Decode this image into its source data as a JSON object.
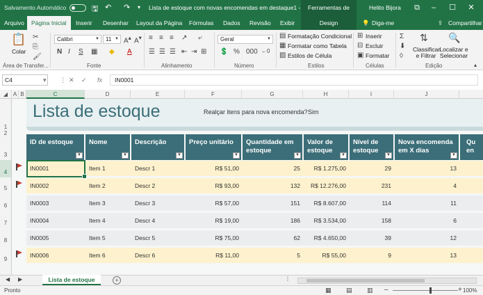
{
  "titlebar": {
    "autosave_label": "Salvamento Automático",
    "doc_title": "Lista de estoque com novas encomendas em destaque1 - Ex...",
    "tools_tab": "Ferramentas de Tabela",
    "user": "Helito Bijora",
    "icons": [
      "save-icon",
      "undo-icon",
      "redo-icon",
      "restore-icon",
      "minimize-icon",
      "maximize-icon",
      "close-icon"
    ]
  },
  "ribbon_tabs": {
    "arquivo": "Arquivo",
    "inicio": "Página Inicial",
    "inserir": "Inserir",
    "desenhar": "Desenhar",
    "layout": "Layout da Página",
    "formulas": "Fórmulas",
    "dados": "Dados",
    "revisao": "Revisão",
    "exibir": "Exibir",
    "design": "Design",
    "tell_me": "Diga-me",
    "share": "Compartilhar"
  },
  "ribbon": {
    "paste": "Colar",
    "font_name": "Calibri",
    "font_size": "11",
    "number_format": "Geral",
    "cond_format": "Formatação Condicional",
    "format_table": "Formatar como Tabela",
    "cell_styles": "Estilos de Célula",
    "insert": "Inserir",
    "delete": "Excluir",
    "format": "Formatar",
    "sort_filter": "Classificar e Filtrar",
    "find_select": "Localizar e Selecionar",
    "groups": {
      "clipboard": "Área de Transfer...",
      "font": "Fonte",
      "alignment": "Alinhamento",
      "number": "Número",
      "styles": "Estilos",
      "cells": "Células",
      "editing": "Edição"
    }
  },
  "formula_bar": {
    "name_box": "C4",
    "formula": "IN0001"
  },
  "columns": [
    "A",
    "B",
    "C",
    "D",
    "E",
    "F",
    "G",
    "H",
    "I",
    "J"
  ],
  "rows": [
    "1",
    "2",
    "3",
    "4",
    "5",
    "6",
    "7",
    "8",
    "9"
  ],
  "sheet": {
    "title": "Lista de estoque",
    "highlight_label": "Realçar itens para nova encomenda?",
    "highlight_value": "Sim",
    "headers": [
      "ID de estoque",
      "Nome",
      "Descrição",
      "Preço unitário",
      "Quantidade em estoque",
      "Valor de estoque",
      "Nível de estoque",
      "Nova encomenda em X dias",
      "Qu en"
    ],
    "table_rows": [
      {
        "id": "IN0001",
        "name": "Item 1",
        "desc": "Descr 1",
        "price": "R$ 51,00",
        "qty": "25",
        "value": "R$ 1.275,00",
        "level": "29",
        "days": "13",
        "reorder": true
      },
      {
        "id": "IN0002",
        "name": "Item 2",
        "desc": "Descr 2",
        "price": "R$ 93,00",
        "qty": "132",
        "value": "R$ 12.276,00",
        "level": "231",
        "days": "4",
        "reorder": true
      },
      {
        "id": "IN0003",
        "name": "Item 3",
        "desc": "Descr 3",
        "price": "R$ 57,00",
        "qty": "151",
        "value": "R$ 8.607,00",
        "level": "114",
        "days": "11",
        "reorder": false
      },
      {
        "id": "IN0004",
        "name": "Item 4",
        "desc": "Descr 4",
        "price": "R$ 19,00",
        "qty": "186",
        "value": "R$ 3.534,00",
        "level": "158",
        "days": "6",
        "reorder": false
      },
      {
        "id": "IN0005",
        "name": "Item 5",
        "desc": "Descr 5",
        "price": "R$ 75,00",
        "qty": "62",
        "value": "R$ 4.650,00",
        "level": "39",
        "days": "12",
        "reorder": false
      },
      {
        "id": "IN0006",
        "name": "Item 6",
        "desc": "Descr 6",
        "price": "R$ 11,00",
        "qty": "5",
        "value": "R$ 55,00",
        "level": "9",
        "days": "13",
        "reorder": true
      }
    ]
  },
  "sheet_tab": "Lista de estoque",
  "status": {
    "ready": "Pronto",
    "zoom": "100%"
  },
  "colors": {
    "excel_green": "#217346",
    "header_teal": "#3b6e78",
    "reorder_row": "#fdf2cd",
    "normal_row": "#ecedef",
    "flag_red": "#c0392b"
  }
}
